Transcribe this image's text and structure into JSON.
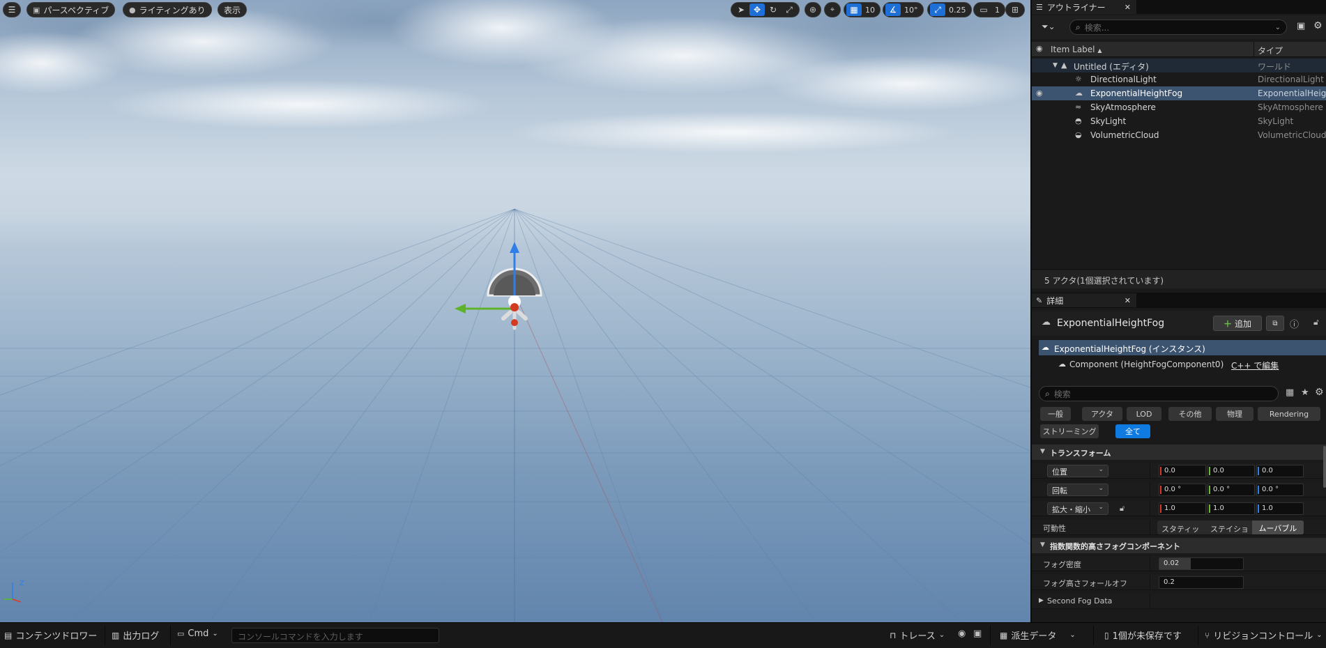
{
  "viewport": {
    "perspective": "パースペクティブ",
    "lighting": "ライティングあり",
    "show": "表示",
    "grid_snap": "10",
    "rotation_snap": "10°",
    "scale_snap": "0.25",
    "camera_speed": "1"
  },
  "outliner": {
    "tab": "アウトライナー",
    "search_placeholder": "検索...",
    "col_label": "Item Label",
    "col_type": "タイプ",
    "rows": [
      {
        "label": "Untitled (エディタ)",
        "type": "ワールド"
      },
      {
        "label": "DirectionalLight",
        "type": "DirectionalLight"
      },
      {
        "label": "ExponentialHeightFog",
        "type": "ExponentialHeigh"
      },
      {
        "label": "SkyAtmosphere",
        "type": "SkyAtmosphere"
      },
      {
        "label": "SkyLight",
        "type": "SkyLight"
      },
      {
        "label": "VolumetricCloud",
        "type": "VolumetricCloud"
      }
    ],
    "selected_index": 2,
    "status": "5 アクタ(1個選択されています)"
  },
  "details": {
    "tab": "詳細",
    "actor_name": "ExponentialHeightFog",
    "add_label": "追加",
    "instance_label": "ExponentialHeightFog (インスタンス)",
    "component_label": "Component (HeightFogComponent0)",
    "edit_cpp": "C++ で編集",
    "search_placeholder": "検索",
    "filters": [
      "一般",
      "アクタ",
      "LOD",
      "その他",
      "物理",
      "Rendering",
      "ストリーミング",
      "全て"
    ],
    "active_filter": "全て",
    "transform": {
      "title": "トランスフォーム",
      "location_label": "位置",
      "rotation_label": "回転",
      "scale_label": "拡大・縮小",
      "location": [
        "0.0",
        "0.0",
        "0.0"
      ],
      "rotation": [
        "0.0 °",
        "0.0 °",
        "0.0 °"
      ],
      "scale": [
        "1.0",
        "1.0",
        "1.0"
      ],
      "mobility_label": "可動性",
      "mobility": [
        "スタティック",
        "ステイショナリ",
        "ムーバブル"
      ],
      "mobility_selected": "ムーバブル"
    },
    "fog": {
      "title": "指数関数的高さフォグコンポーネント",
      "density_label": "フォグ密度",
      "density": "0.02",
      "falloff_label": "フォグ高さフォールオフ",
      "falloff": "0.2",
      "second_fog": "Second Fog Data"
    }
  },
  "bottom": {
    "content_drawer": "コンテンツドロワー",
    "output_log": "出力ログ",
    "cmd": "Cmd",
    "console_placeholder": "コンソールコマンドを入力します",
    "trace": "トレース",
    "derived_data": "派生データ",
    "unsaved": "1個が未保存です",
    "revision_control": "リビジョンコントロール"
  },
  "colors": {
    "accent": "#0f7ae0",
    "selection": "#3d5470",
    "axis_x": "#d8392a",
    "axis_y": "#6cb834",
    "axis_z": "#2f7fe6"
  }
}
